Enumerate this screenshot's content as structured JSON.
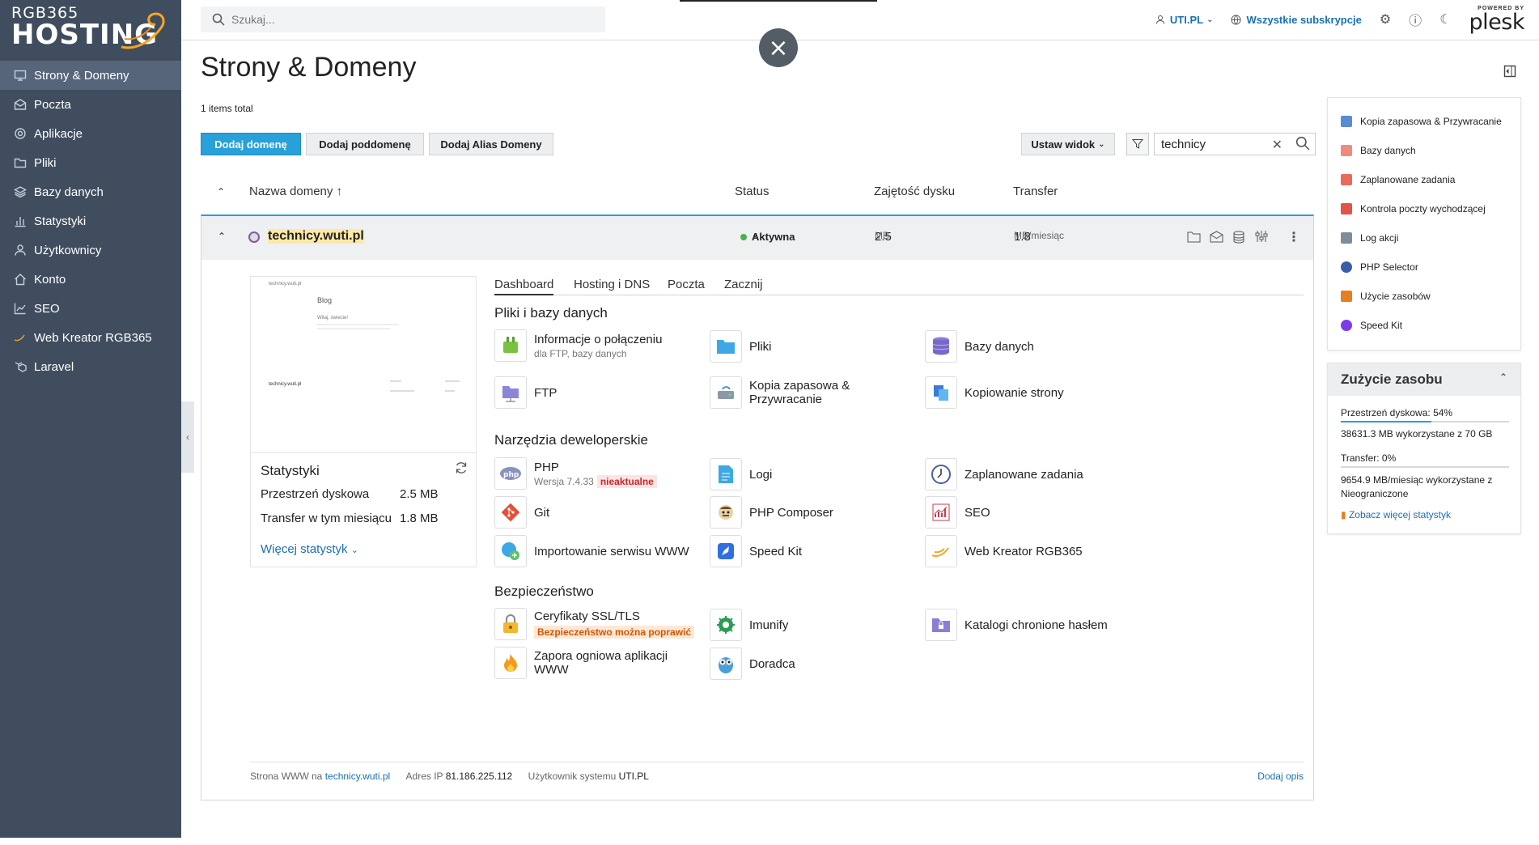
{
  "sidebar": {
    "logo_line1": "RGB365",
    "logo_line2": "HOSTING",
    "items": [
      {
        "label": "Strony & Domeny",
        "icon": "monitor-icon"
      },
      {
        "label": "Poczta",
        "icon": "mail-icon"
      },
      {
        "label": "Aplikacje",
        "icon": "gear-icon"
      },
      {
        "label": "Pliki",
        "icon": "folder-icon"
      },
      {
        "label": "Bazy danych",
        "icon": "layers-icon"
      },
      {
        "label": "Statystyki",
        "icon": "bar-chart-icon"
      },
      {
        "label": "Użytkownicy",
        "icon": "user-icon"
      },
      {
        "label": "Konto",
        "icon": "home-icon"
      },
      {
        "label": "SEO",
        "icon": "trend-icon"
      },
      {
        "label": "Web Kreator RGB365",
        "icon": "web-kreator-icon"
      },
      {
        "label": "Laravel",
        "icon": "laravel-icon"
      }
    ]
  },
  "topbar": {
    "search_placeholder": "Szukaj...",
    "user": "UTI.PL",
    "subscriptions": "Wszystkie subskrypcje",
    "plesk_powered": "POWERED BY",
    "plesk_name": "plesk"
  },
  "main": {
    "title": "Strony & Domeny",
    "items_total": "1 items total",
    "buttons": {
      "add_domain": "Dodaj domenę",
      "add_subdomain": "Dodaj poddomenę",
      "add_alias": "Dodaj Alias Domeny",
      "view": "Ustaw widok"
    },
    "filter_value": "technicy",
    "columns": {
      "name": "Nazwa domeny ↑",
      "status": "Status",
      "disk": "Zajętość dysku",
      "transfer": "Transfer"
    },
    "row": {
      "domain": "technicy.wuti.pl",
      "status": "Aktywna",
      "disk_value": "2.5",
      "disk_unit": "MB",
      "transfer_value": "1.8",
      "transfer_unit": "MB/miesiąc"
    }
  },
  "preview": {
    "site": "technicy.wuti.pl",
    "blog": "Blog",
    "welcome": "Witaj, świecie!",
    "footer_site": "technicy.wuti.pl"
  },
  "stats": {
    "title": "Statystyki",
    "disk_label": "Przestrzeń dyskowa",
    "disk_value": "2.5 MB",
    "transfer_label": "Transfer w tym miesiącu",
    "transfer_value": "1.8 MB",
    "more": "Więcej statystyk"
  },
  "tabs": [
    "Dashboard",
    "Hosting i DNS",
    "Poczta",
    "Zacznij"
  ],
  "sections": {
    "files": "Pliki i bazy danych",
    "dev": "Narzędzia deweloperskie",
    "security": "Bezpieczeństwo"
  },
  "tools": {
    "conn_info": "Informacje o połączeniu",
    "conn_info_sub": "dla FTP, bazy danych",
    "files": "Pliki",
    "databases": "Bazy danych",
    "ftp": "FTP",
    "backup": "Kopia zapasowa & Przywracanie",
    "copy_site": "Kopiowanie strony",
    "php": "PHP",
    "php_sub": "Wersja 7.4.33",
    "php_badge": "nieaktualne",
    "logs": "Logi",
    "scheduled": "Zaplanowane zadania",
    "git": "Git",
    "composer": "PHP Composer",
    "seo": "SEO",
    "import": "Importowanie serwisu WWW",
    "speedkit": "Speed Kit",
    "webkreator": "Web Kreator RGB365",
    "ssl": "Ceryfikaty SSL/TLS",
    "ssl_badge": "Bezpieczeństwo można poprawić",
    "imunify": "Imunify",
    "protected_dirs": "Katalogi chronione hasłem",
    "waf": "Zapora ogniowa aplikacji WWW",
    "advisor": "Doradca"
  },
  "footer": {
    "site_label": "Strona WWW na",
    "site_link": "technicy.wuti.pl",
    "ip_label": "Adres IP",
    "ip": "81.186.225.112",
    "user_label": "Użytkownik systemu",
    "user": "UTI.PL",
    "add_desc": "Dodaj opis"
  },
  "right_panel": {
    "items": [
      "Kopia zapasowa & Przywracanie",
      "Bazy danych",
      "Zaplanowane zadania",
      "Kontrola poczty wychodzącej",
      "Log akcji",
      "PHP Selector",
      "Użycie zasobów",
      "Speed Kit"
    ],
    "item_colors": [
      "#5b8bd0",
      "#f08a7e",
      "#e96b5c",
      "#e2544a",
      "#7f8c9a",
      "#3a5fa8",
      "#e67e22",
      "#7c3aed"
    ]
  },
  "usage": {
    "title": "Zużycie zasobu",
    "disk_label": "Przestrzeń dyskowa:",
    "disk_pct": "54%",
    "disk_fraction": 0.54,
    "disk_detail": "38631.3 MB wykorzystane z 70 GB",
    "transfer_label": "Transfer:",
    "transfer_pct": "0%",
    "transfer_fraction": 0.0,
    "transfer_detail": "9654.9 MB/miesiąc wykorzystane z Nieograniczone",
    "more": "Zobacz więcej statystyk"
  }
}
